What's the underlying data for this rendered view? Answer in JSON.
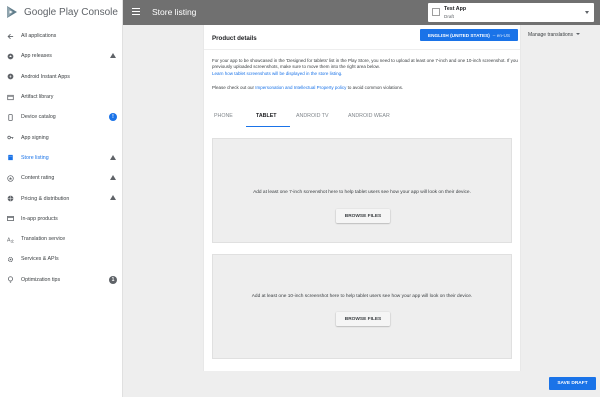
{
  "brand": {
    "title": "Google Play Console"
  },
  "sidebar": {
    "items": [
      {
        "label": "All applications",
        "icon": "arrow-left-icon"
      },
      {
        "label": "App releases",
        "icon": "rocket-icon",
        "warning": true
      },
      {
        "label": "Android Instant Apps",
        "icon": "bolt-icon"
      },
      {
        "label": "Artifact library",
        "icon": "folder-icon"
      },
      {
        "label": "Device catalog",
        "icon": "phone-icon",
        "badge": "!",
        "badge_color": "#1a73e8"
      },
      {
        "label": "App signing",
        "icon": "key-icon"
      },
      {
        "label": "Store listing",
        "icon": "store-icon",
        "warning": true,
        "active": true
      },
      {
        "label": "Content rating",
        "icon": "star-icon",
        "warning": true
      },
      {
        "label": "Pricing & distribution",
        "icon": "globe-icon",
        "warning": true
      },
      {
        "label": "In-app products",
        "icon": "card-icon"
      },
      {
        "label": "Translation service",
        "icon": "translate-icon"
      },
      {
        "label": "Services & APIs",
        "icon": "gear-icon"
      },
      {
        "label": "Optimization tips",
        "icon": "bulb-icon",
        "badge": "1",
        "badge_color": "#5f6368"
      }
    ]
  },
  "header": {
    "title": "Store listing"
  },
  "app_selector": {
    "name": "Test App",
    "status": "Draft"
  },
  "product": {
    "title": "Product details",
    "language_button": "ENGLISH (UNITED STATES)",
    "language_suffix": "– en-US",
    "manage_translations": "Manage translations",
    "info_line1": "For your app to be showcased in the 'Designed for tablets' list in the Play Store, you need to upload at least one 7-inch and one 10-inch screenshot. If you",
    "info_line2": "previously uploaded screenshots, make sure to move them into the right area below.",
    "info_link": "Learn how tablet screenshots will be displayed in the store listing.",
    "policy_prefix": "Please check out our ",
    "policy_link": "Impersonation and Intellectual Property policy",
    "policy_suffix": " to avoid common violations."
  },
  "tabs": [
    {
      "label": "PHONE",
      "active": false
    },
    {
      "label": "TABLET",
      "active": true
    },
    {
      "label": "ANDROID TV",
      "active": false
    },
    {
      "label": "ANDROID WEAR",
      "active": false
    }
  ],
  "dropzones": [
    {
      "text": "Add at least one 7-inch screenshot here to help tablet users see how your app will look on their device.",
      "button": "BROWSE FILES"
    },
    {
      "text": "Add at least one 10-inch screenshot here to help tablet users see how your app will look on their device.",
      "button": "BROWSE FILES"
    }
  ],
  "footer": {
    "save_label": "SAVE DRAFT"
  },
  "colors": {
    "accent": "#1a73e8",
    "topbar": "#707070",
    "page_bg": "#eeeeee"
  }
}
